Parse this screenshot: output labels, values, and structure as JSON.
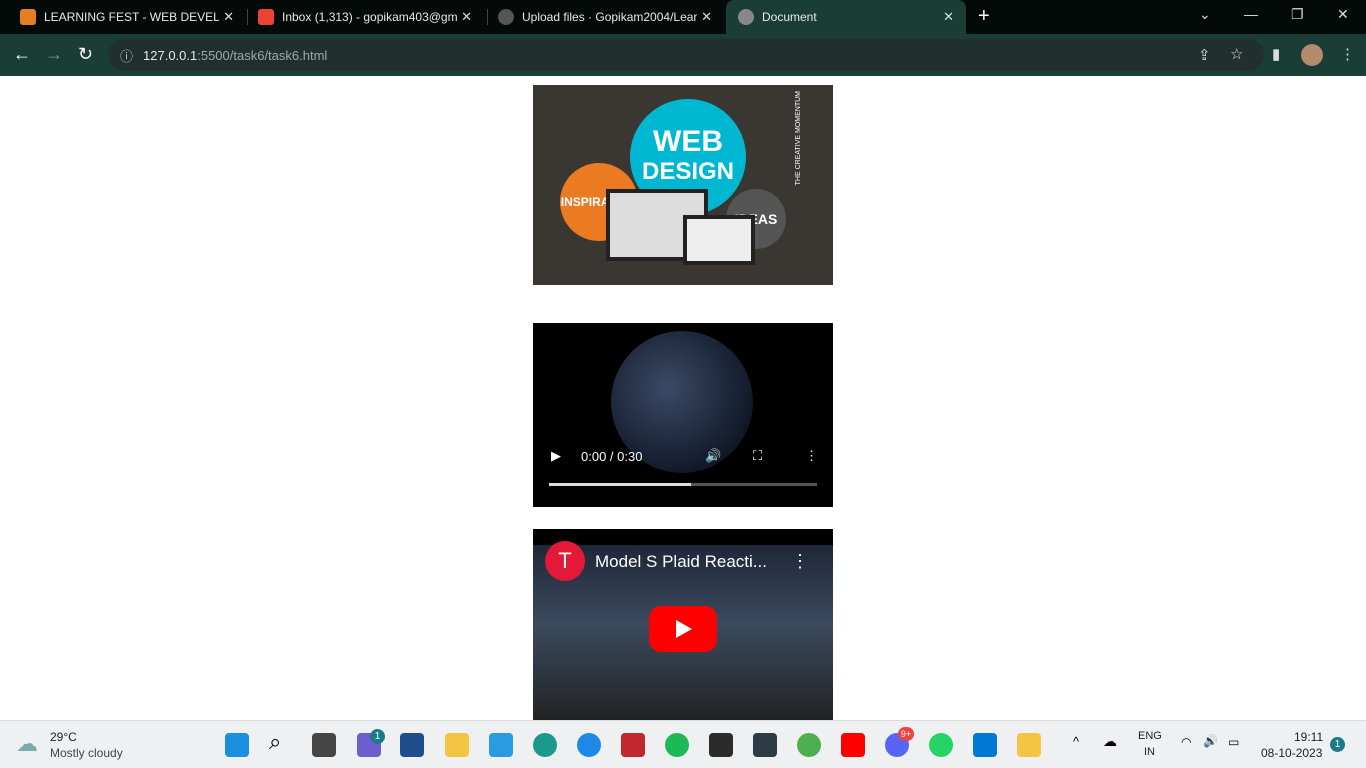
{
  "browser": {
    "tabs": [
      {
        "title": "LEARNING FEST - WEB DEVELOP",
        "icon": "flame-icon",
        "color": "#e67e22"
      },
      {
        "title": "Inbox (1,313) - gopikam403@gm",
        "icon": "gmail-icon",
        "color": "#ea4335"
      },
      {
        "title": "Upload files · Gopikam2004/Lear",
        "icon": "github-icon",
        "color": "#555"
      },
      {
        "title": "Document",
        "icon": "globe-icon",
        "color": "#888"
      }
    ],
    "close": "✕",
    "new_tab": "+",
    "url_host": "127.0.0.1",
    "url_path": ":5500/task6/task6.html"
  },
  "page": {
    "image": {
      "big": "WEB",
      "big2": "DESIGN",
      "left": "INSPIRATION",
      "right": "IDEAS",
      "brand": "THE CREATIVE MOMENTUM"
    },
    "video": {
      "time": "0:00 / 0:30",
      "progress": 0.53
    },
    "youtube": {
      "title": "Model S Plaid Reacti..."
    }
  },
  "taskbar": {
    "weather_temp": "29°C",
    "weather_desc": "Mostly cloudy",
    "chat_badge": "1",
    "discord_badge": "9+",
    "lang": "ENG",
    "region": "IN",
    "time": "19:11",
    "date": "08-10-2023",
    "notif": "1"
  }
}
